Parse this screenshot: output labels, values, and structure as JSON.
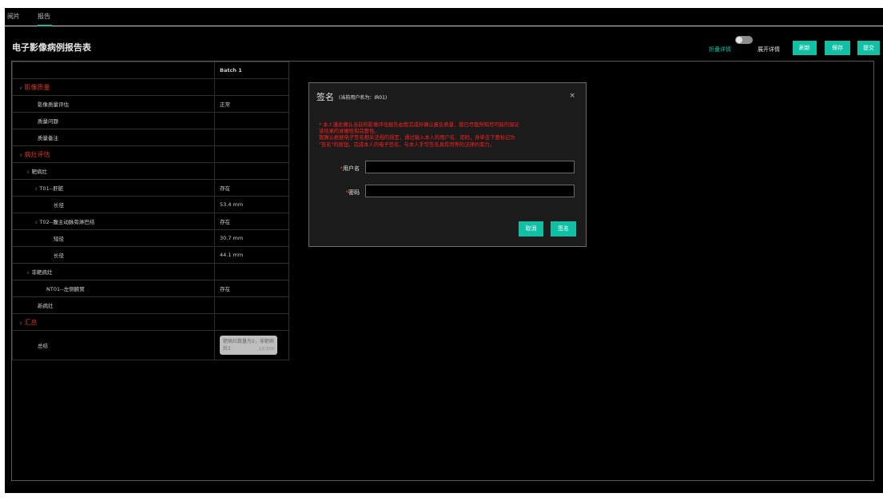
{
  "tabs": [
    {
      "label": "阅片"
    },
    {
      "label": "报告"
    }
  ],
  "page_title": "电子影像病例报告表",
  "toolbar": {
    "collapse_label": "折叠详情",
    "expand_label": "展开详情",
    "refresh_label": "刷新",
    "save_label": "保存",
    "submit_label": "提交",
    "toggle_on": false
  },
  "table": {
    "column_header": "Batch 1",
    "rows": [
      {
        "label": "影像质量",
        "value": ""
      },
      {
        "label": "影像质量评估",
        "value": "正常"
      },
      {
        "label": "质量问题",
        "value": ""
      },
      {
        "label": "质量备注",
        "value": ""
      },
      {
        "label": "病灶评估",
        "value": ""
      },
      {
        "label": "靶病灶",
        "value": ""
      },
      {
        "label": "T01--肝脏",
        "value": "存在"
      },
      {
        "label": "长径",
        "value": "53.4 mm"
      },
      {
        "label": "T02--腹主动脉旁淋巴结",
        "value": "存在"
      },
      {
        "label": "短径",
        "value": "30.7 mm"
      },
      {
        "label": "长径",
        "value": "44.1 mm"
      },
      {
        "label": "非靶病灶",
        "value": ""
      },
      {
        "label": "NT01--左侧腋窝",
        "value": "存在"
      },
      {
        "label": "新病灶",
        "value": ""
      },
      {
        "label": "汇总",
        "value": ""
      },
      {
        "label": "总结",
        "value": ""
      }
    ],
    "summary_text": "靶病灶数量为2，非靶病灶1",
    "summary_count": "13/100"
  },
  "modal": {
    "title": "签名",
    "subtitle": "(当前用户名为：IR01)",
    "close_glyph": "×",
    "notice_lines": [
      "* 本人谨此确认当前的影像评估报告由我完成并确认报告质量，我已尽我所知尽可能的保证",
      "该结果的准确性和完整性。",
      "我确认根据电子签名相关法规的规定，通过输入本人的用户名、密码，并单击下面标记为",
      "\"签名\"的按钮，完成本人的电子签名，与本人手写签名具有同等的法律约束力。"
    ],
    "username_label": "用户名",
    "password_label": "密码",
    "required_mark": "*",
    "cancel_label": "取消",
    "sign_label": "签名"
  },
  "colors": {
    "accent": "#10c0a5",
    "danger": "#d9362a",
    "background": "#000000",
    "modal_bg": "#1b1b1b"
  }
}
